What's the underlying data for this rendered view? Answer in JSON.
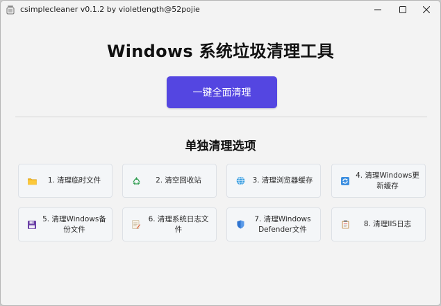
{
  "window": {
    "title": "csimplecleaner v0.1.2 by violetlength@52pojie",
    "controls": [
      "minimize",
      "maximize",
      "close"
    ]
  },
  "main": {
    "title": "Windows 系统垃圾清理工具",
    "one_click_label": "一键全面清理",
    "section_title": "单独清理选项",
    "accent_color": "#5446e1"
  },
  "options": [
    {
      "label": "1. 清理临时文件",
      "icon": "folder-icon"
    },
    {
      "label": "2. 清空回收站",
      "icon": "recycle-icon"
    },
    {
      "label": "3. 清理浏览器缓存",
      "icon": "globe-icon"
    },
    {
      "label": "4. 清理Windows更新缓存",
      "icon": "refresh-icon"
    },
    {
      "label": "5. 清理Windows备份文件",
      "icon": "floppy-disk-icon"
    },
    {
      "label": "6. 清理系统日志文件",
      "icon": "memo-icon"
    },
    {
      "label": "7. 清理Windows Defender文件",
      "icon": "shield-icon"
    },
    {
      "label": "8. 清理IIS日志",
      "icon": "clipboard-icon"
    }
  ]
}
